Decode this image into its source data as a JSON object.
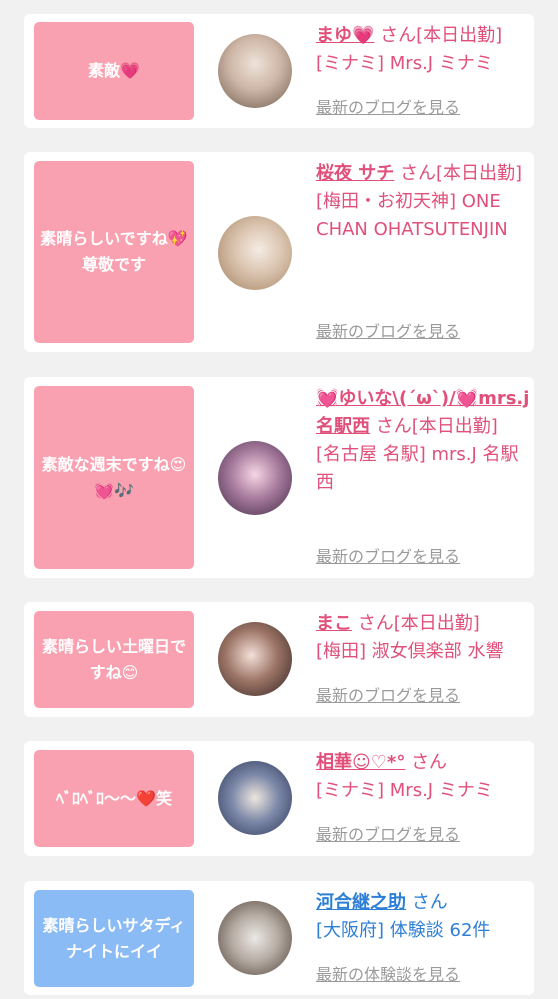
{
  "cards": [
    {
      "message": "素敵💗",
      "name": "まゆ💗",
      "san": "さん[本日出勤]",
      "shop": "[ミナミ] Mrs.J ミナミ",
      "link": "最新のブログを見る",
      "avatar_colors": [
        "#d6c2b4",
        "#6e5a4e"
      ]
    },
    {
      "message": "素晴らしいですね💖尊敬です",
      "name": "桜夜 サチ",
      "san": "さん[本日出勤]",
      "shop": "[梅田・お初天神] ONE CHAN OHATSUTENJIN",
      "link": "最新のブログを見る",
      "avatar_colors": [
        "#e8d8c8",
        "#b08e6e"
      ]
    },
    {
      "message": "素敵な週末ですね😍💓🎶",
      "name": "💓ゆいな\\(´ω`)/💓mrs.j名駅西",
      "san": "さん[本日出勤]",
      "shop": "[名古屋 名駅] mrs.J 名駅西",
      "link": "最新のブログを見る",
      "avatar_colors": [
        "#5b3a5e",
        "#f0c8d8"
      ]
    },
    {
      "message": "素晴らしい土曜日ですね😊",
      "name": "まこ",
      "san": "さん[本日出勤]",
      "shop": "[梅田] 淑女倶楽部 水響",
      "link": "最新のブログを見る",
      "avatar_colors": [
        "#3a2a24",
        "#f2dcd4"
      ]
    },
    {
      "message": "ﾍﾞﾛﾍﾞﾛ〜〜❤️笑",
      "name": "相華☺︎♡*°",
      "san": "さん",
      "shop": "[ミナミ] Mrs.J ミナミ",
      "link": "最新のブログを見る",
      "avatar_colors": [
        "#3b4f7a",
        "#e8e0d8"
      ]
    },
    {
      "message": "素晴らしいサタディナイトにイイ",
      "name": "河合継之助",
      "san": "さん",
      "shop": "[大阪府] 体験談 62件",
      "link": "最新の体験談を見る",
      "avatar_colors": [
        "#c8c2bc",
        "#5a4a40"
      ]
    }
  ]
}
